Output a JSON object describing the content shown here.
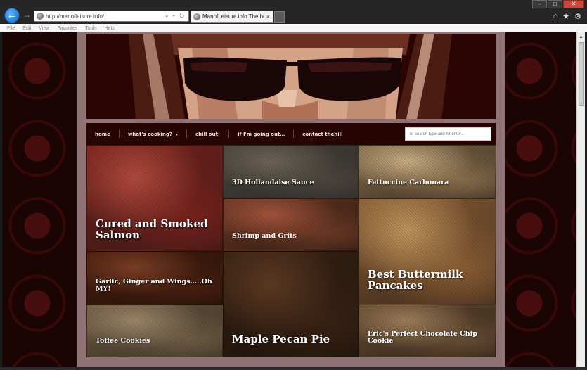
{
  "browser": {
    "url": "http://manofleisure.info/",
    "tab_title": "ManofLeisure.info The ho...",
    "tab_close": "×",
    "back_glyph": "←",
    "forward_glyph": "→",
    "address_icons": "⌕ ▾ ↻",
    "window_buttons": {
      "minimize": "–",
      "maximize": "□",
      "close": "✕"
    },
    "toolbar_icons": {
      "home": "⌂",
      "favorites": "★",
      "tools": "⚙"
    },
    "menu": [
      "File",
      "Edit",
      "View",
      "Favorites",
      "Tools",
      "Help"
    ]
  },
  "site": {
    "nav": [
      {
        "label": "home"
      },
      {
        "label": "what's cooking?",
        "dropdown": "▾"
      },
      {
        "label": "chill out!"
      },
      {
        "label": "if I'm going out…"
      },
      {
        "label": "contact thehill"
      }
    ],
    "search_placeholder": "To search type and hit enter..."
  },
  "tiles": [
    {
      "id": "cured-salmon",
      "title": "Cured and Smoked Salmon",
      "size": "large",
      "palette": [
        "#b24a3e",
        "#7a221c",
        "#3a1a18"
      ]
    },
    {
      "id": "hollandaise",
      "title": "3D Hollandaise Sauce",
      "size": "small",
      "palette": [
        "#6d6458",
        "#4c463f",
        "#2e2a26"
      ]
    },
    {
      "id": "carbonara",
      "title": "Fettuccine Carbonara",
      "size": "small",
      "palette": [
        "#c8ad82",
        "#8a6f4d",
        "#3a2e22"
      ]
    },
    {
      "id": "shrimp-grits",
      "title": "Shrimp and Grits",
      "size": "small",
      "palette": [
        "#a4533a",
        "#6d3a26",
        "#2c1a12"
      ]
    },
    {
      "id": "pancakes",
      "title": "Best Buttermilk Pancakes",
      "size": "large",
      "palette": [
        "#c0945c",
        "#8c5f34",
        "#3d2a1c"
      ]
    },
    {
      "id": "wings",
      "title": "Garlic, Ginger and Wings…..Oh MY!",
      "size": "small",
      "palette": [
        "#7b3e25",
        "#4a2010",
        "#231108"
      ]
    },
    {
      "id": "pecan-pie",
      "title": "Maple Pecan Pie",
      "size": "large",
      "palette": [
        "#5d3a22",
        "#3a2314",
        "#1d120b"
      ]
    },
    {
      "id": "toffee",
      "title": "Toffee Cookies",
      "size": "small",
      "palette": [
        "#9c8669",
        "#6f5c44",
        "#3b3124"
      ]
    },
    {
      "id": "choc-chip",
      "title": "Eric's Perfect Chocolate Chip Cookie",
      "size": "small",
      "palette": [
        "#9d7d5a",
        "#6a4f35",
        "#2f2217"
      ]
    }
  ]
}
